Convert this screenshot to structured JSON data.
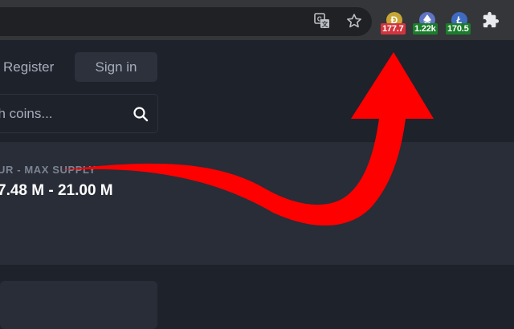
{
  "browser": {
    "extensions": [
      {
        "icon": "dogecoin-coin-icon",
        "badge": "177.7",
        "badge_color": "#d1343d",
        "coin_color": "#c9a634"
      },
      {
        "icon": "ethereum-coin-icon",
        "badge": "1.22k",
        "badge_color": "#1b7d2c",
        "coin_color": "#5f74c4"
      },
      {
        "icon": "litecoin-coin-icon",
        "badge": "170.5",
        "badge_color": "#1b7d2c",
        "coin_color": "#3e6bbf"
      }
    ]
  },
  "header": {
    "register_label": "Register",
    "signin_label": "Sign in"
  },
  "search": {
    "placeholder": "ch coins..."
  },
  "supply": {
    "label": "UR - MAX SUPPLY",
    "value": "7.48 M - 21.00 M"
  },
  "colors": {
    "page_bg": "#1e222b",
    "card_bg": "#282d37",
    "toolbar_bg": "#35363a",
    "arrow": "#ff0000"
  }
}
